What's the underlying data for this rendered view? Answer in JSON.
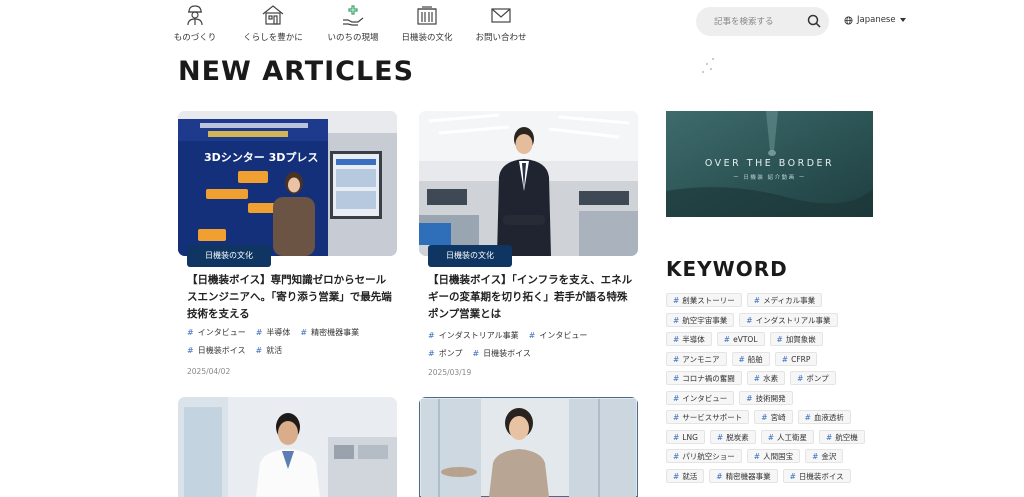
{
  "nav": {
    "items": [
      {
        "label": "ものづくり",
        "icon": "worker-icon"
      },
      {
        "label": "くらしを豊かに",
        "icon": "house-icon"
      },
      {
        "label": "いのちの現場",
        "icon": "care-hand-icon"
      },
      {
        "label": "日機装の文化",
        "icon": "building-icon"
      },
      {
        "label": "お問い合わせ",
        "icon": "mail-icon"
      }
    ],
    "search_placeholder": "記事を検索する",
    "language": "Japanese"
  },
  "heading": "NEW ARTICLES",
  "articles": [
    {
      "category": "日機装の文化",
      "title": "【日機装ボイス】専門知識ゼロからセールスエンジニアへ。「寄り添う営業」で最先端技術を支える",
      "tags": [
        "インタビュー",
        "半導体",
        "精密機器事業",
        "日機装ボイス",
        "就活"
      ],
      "date": "2025/04/02"
    },
    {
      "category": "日機装の文化",
      "title": "【日機装ボイス】「インフラを支え、エネルギーの変革期を切り拓く」若手が語る特殊ポンプ営業とは",
      "tags": [
        "インダストリアル事業",
        "インタビュー",
        "ポンプ",
        "日機装ボイス"
      ],
      "date": "2025/03/19"
    }
  ],
  "banner": {
    "title": "OVER THE BORDER",
    "subtitle": "ー 日機装 紹介動画 ー"
  },
  "keyword_title": "KEYWORD",
  "keywords": [
    "創業ストーリー",
    "メディカル事業",
    "航空宇宙事業",
    "インダストリアル事業",
    "半導体",
    "eVTOL",
    "加賀象嵌",
    "アンモニア",
    "船舶",
    "CFRP",
    "コロナ禍の奮闘",
    "水素",
    "ポンプ",
    "インタビュー",
    "技術開発",
    "サービスサポート",
    "宮崎",
    "血液透析",
    "LNG",
    "脱炭素",
    "人工衛星",
    "航空機",
    "パリ航空ショー",
    "人間国宝",
    "金沢",
    "就活",
    "精密機器事業",
    "日機装ボイス"
  ],
  "colors": {
    "category_bg": "#0f3563",
    "hash": "#3b6fc2"
  }
}
